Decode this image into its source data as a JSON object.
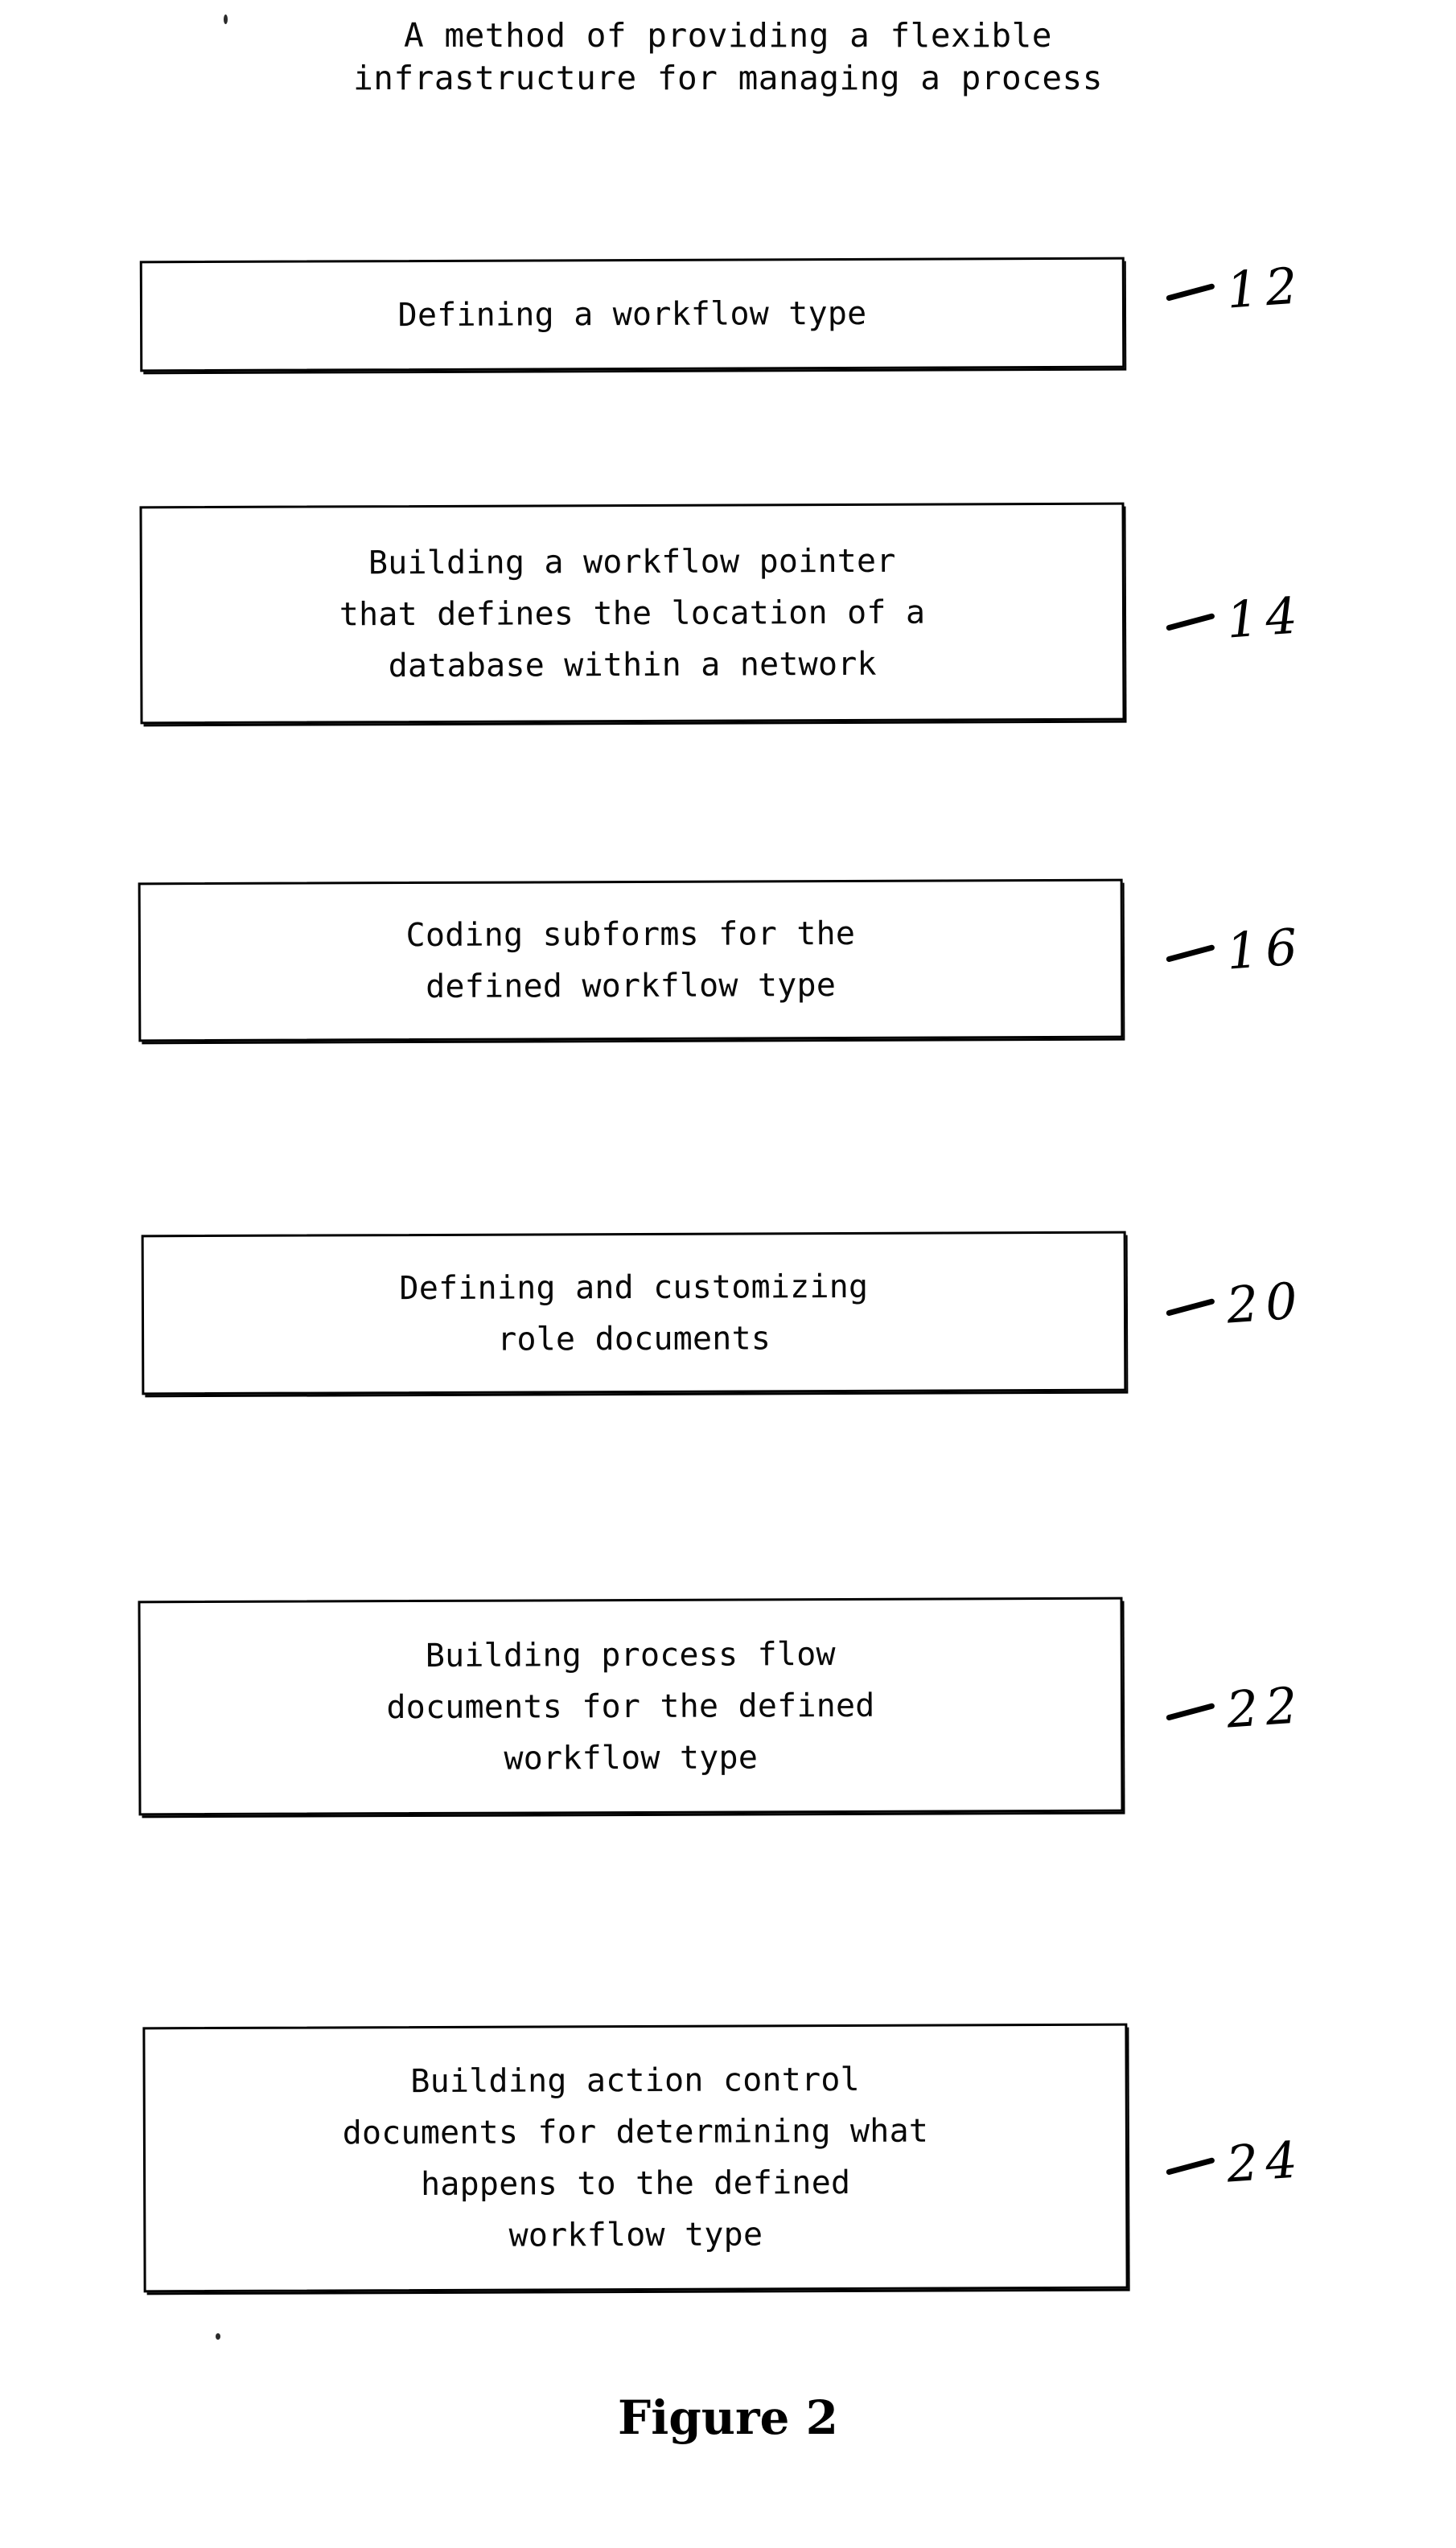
{
  "figure": {
    "title_lines": [
      "A method of providing a flexible",
      "infrastructure for managing a process"
    ],
    "caption": "Figure 2",
    "ink_color": "#000000",
    "background_color": "#ffffff"
  },
  "steps": [
    {
      "ref": "12",
      "ref_dash": "—",
      "text": "Defining a workflow type",
      "lines": [
        "Defining a workflow type"
      ]
    },
    {
      "ref": "14",
      "ref_dash": "—",
      "text": "Building a workflow pointer\nthat defines the location of a\ndatabase within a network",
      "lines": [
        "Building a workflow pointer",
        "that defines the location of a",
        "database within a network"
      ]
    },
    {
      "ref": "16",
      "ref_dash": "—",
      "text": "Coding subforms for the\ndefined workflow type",
      "lines": [
        "Coding subforms for the",
        "defined workflow type"
      ]
    },
    {
      "ref": "20",
      "ref_dash": "—",
      "text": "Defining and customizing\nrole documents",
      "lines": [
        "Defining and customizing",
        "role documents"
      ]
    },
    {
      "ref": "22",
      "ref_dash": "—",
      "text": "Building process flow\ndocuments for the defined\nworkflow type",
      "lines": [
        "Building process flow",
        "documents for the defined",
        "workflow type"
      ]
    },
    {
      "ref": "24",
      "ref_dash": "—",
      "text": "Building action control\ndocuments for determining what\nhappens to the defined\nworkflow type",
      "lines": [
        "Building action control",
        "documents for determining what",
        "happens to the defined",
        "workflow type"
      ]
    }
  ]
}
